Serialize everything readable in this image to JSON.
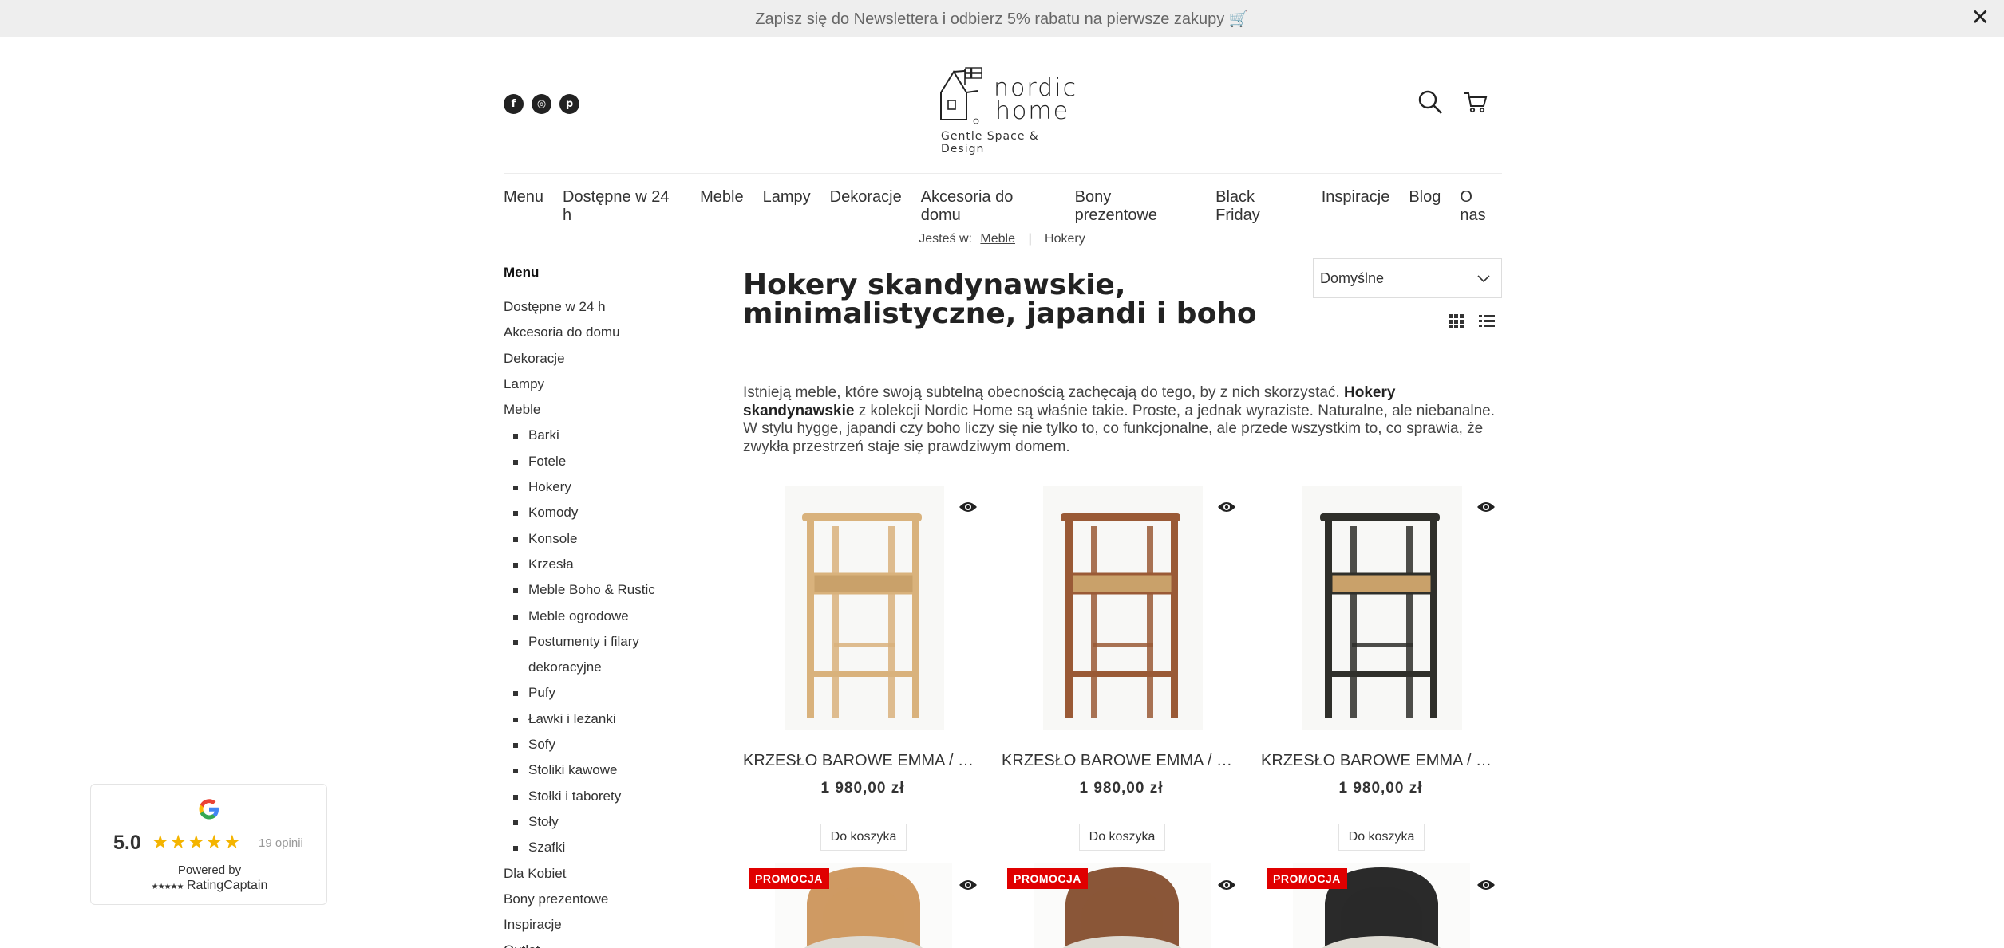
{
  "topbar": {
    "text": "Zapisz się do Newslettera i odbierz 5% rabatu na pierwsze zakupy 🛒",
    "close": "✕"
  },
  "header": {
    "social": [
      {
        "name": "facebook-icon",
        "glyph": "f"
      },
      {
        "name": "instagram-icon",
        "glyph": "◎"
      },
      {
        "name": "pinterest-icon",
        "glyph": "p"
      }
    ],
    "logo_line1": "nordic",
    "logo_line2": "home",
    "logo_tagline": "Gentle Space & Design"
  },
  "nav": [
    "Menu",
    "Dostępne w 24 h",
    "Meble",
    "Lampy",
    "Dekoracje",
    "Akcesoria do domu",
    "Bony prezentowe",
    "Black Friday",
    "Inspiracje",
    "Blog",
    "O nas"
  ],
  "breadcrumb": {
    "prefix": "Jesteś w:",
    "parent": "Meble",
    "separator": "|",
    "current": "Hokery"
  },
  "sidebar": {
    "heading": "Menu",
    "top_before": [
      "Dostępne w 24 h",
      "Akcesoria do domu",
      "Dekoracje",
      "Lampy",
      "Meble"
    ],
    "sub": [
      "Barki",
      "Fotele",
      "Hokery",
      "Komody",
      "Konsole",
      "Krzesła",
      "Meble Boho & Rustic",
      "Meble ogrodowe",
      "Postumenty i filary dekoracyjne",
      "Pufy",
      "Ławki i leżanki",
      "Sofy",
      "Stoliki kawowe",
      "Stołki i taborety",
      "Stoły",
      "Szafki"
    ],
    "top_after": [
      "Dla Kobiet",
      "Bony prezentowe",
      "Inspiracje",
      "Outlet"
    ]
  },
  "main": {
    "title": "Hokery skandynawskie, minimalistyczne, japandi i boho",
    "sort_value": "Domyślne",
    "intro_before": "Istnieją meble, które swoją subtelną obecnością zachęcają do tego, by z nich skorzystać. ",
    "intro_bold": "Hokery skandynawskie",
    "intro_after": " z kolekcji Nordic Home są właśnie takie. Proste, a jednak wyraziste. Naturalne, ale niebanalne. W stylu hygge, japandi czy boho liczy się nie tylko to, co funkcjonalne, ale przede wszystkim to, co sprawia, że zwykła przestrzeń staje się prawdziwym domem."
  },
  "products": [
    {
      "name": "KRZESŁO BAROWE EMMA / HOKER NATURAL",
      "price": "1 980,00 zł",
      "cart": "Do koszyka",
      "wood": "#d9b27c"
    },
    {
      "name": "KRZESŁO BAROWE EMMA / HOKER BROWN",
      "price": "1 980,00 zł",
      "cart": "Do koszyka",
      "wood": "#9a5a36"
    },
    {
      "name": "KRZESŁO BAROWE EMMA / HOKER BLACK",
      "price": "1 980,00 zł",
      "cart": "Do koszyka",
      "wood": "#2f2f2a"
    }
  ],
  "products_row2": [
    {
      "badge": "PROMOCJA",
      "wood": "#cf9a63"
    },
    {
      "badge": "PROMOCJA",
      "wood": "#8a5638"
    },
    {
      "badge": "PROMOCJA",
      "wood": "#2a2a2a"
    }
  ],
  "rating": {
    "score": "5.0",
    "stars": "★★★★★",
    "count": "19 opinii",
    "powered": "Powered by",
    "brand_stars": "★★★★★",
    "brand": "RatingCaptain"
  },
  "colors": {
    "promo": "#e00000",
    "star": "#f4b400",
    "topbar_bg": "#eeeeee"
  }
}
